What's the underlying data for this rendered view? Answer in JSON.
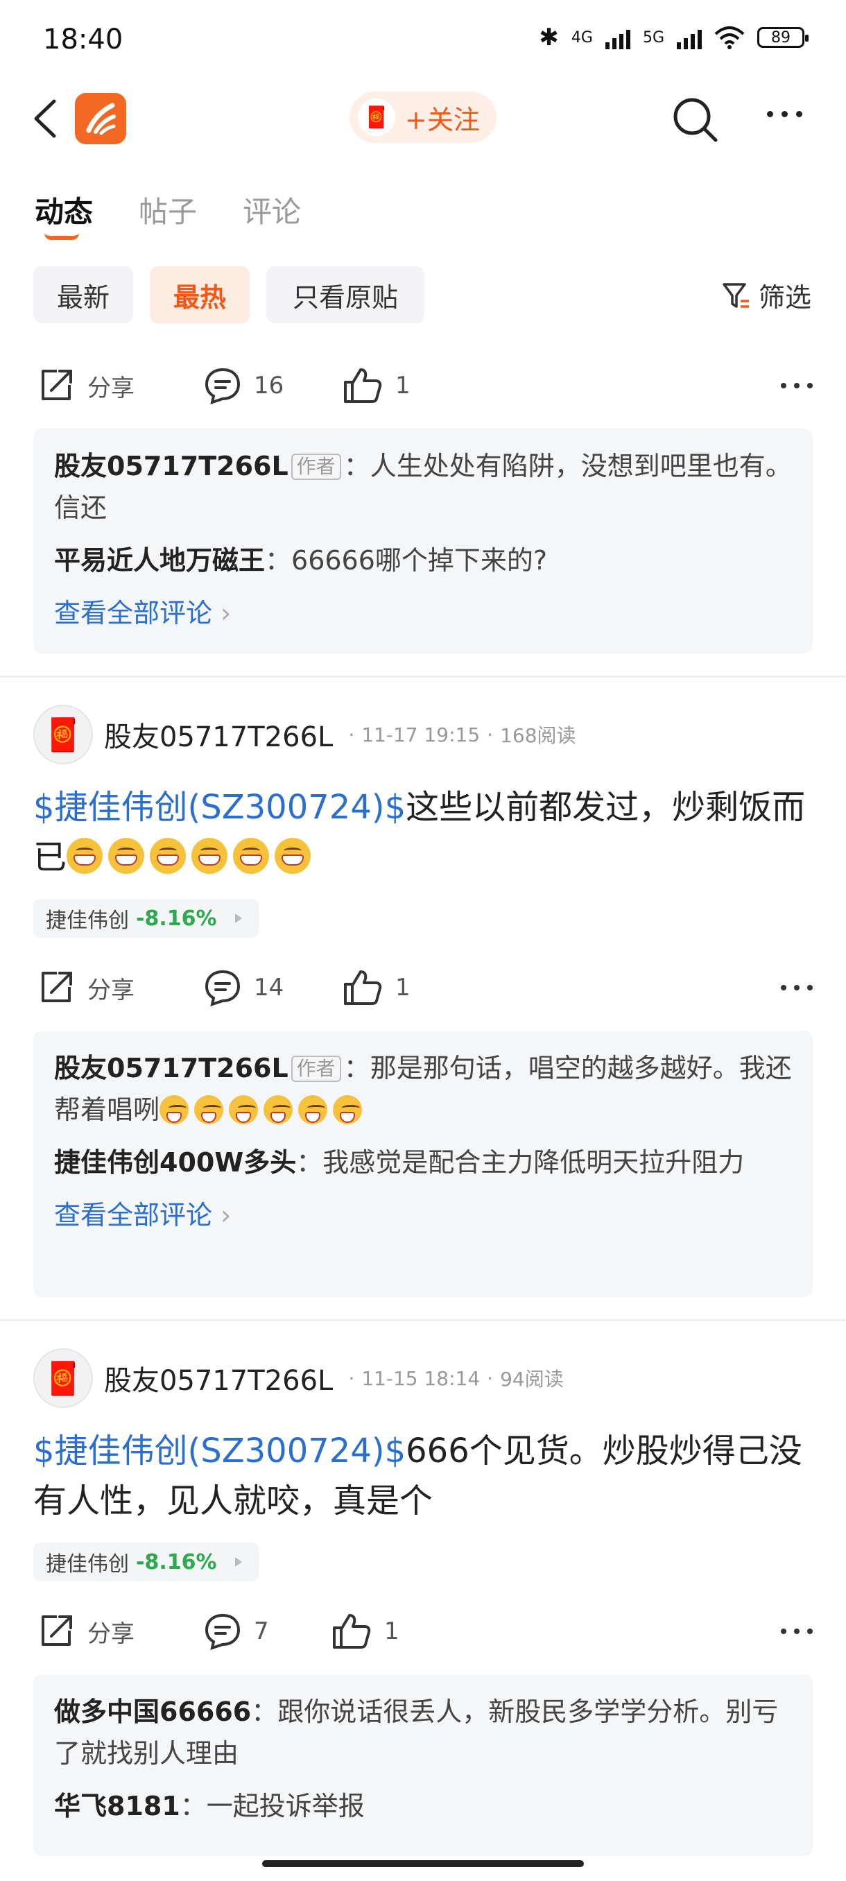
{
  "status_bar": {
    "time": "18:40",
    "net1": "4G",
    "net2": "5G",
    "battery": "89"
  },
  "header": {
    "follow_label": "+关注"
  },
  "tabs": [
    "动态",
    "帖子",
    "评论"
  ],
  "filters": [
    "最新",
    "最热",
    "只看原贴"
  ],
  "filter_button": "筛选",
  "actions": {
    "share": "分享",
    "row1": {
      "comments": "16",
      "likes": "1"
    },
    "row2": {
      "comments": "14",
      "likes": "1"
    },
    "row3": {
      "comments": "7",
      "likes": "1"
    }
  },
  "author_tag": "作者",
  "view_all": "查看全部评论",
  "block1": {
    "c1_name": "股友05717T266L",
    "c1_text": "：人生处处有陷阱，没想到吧里也有。信还",
    "c2_name": "平易近人地万磁王",
    "c2_text": "：66666哪个掉下来的?"
  },
  "post1": {
    "username": "股友05717T266L",
    "date": "11-17 19:15",
    "reads": "168阅读",
    "stock_link": "$捷佳伟创(SZ300724)$",
    "text": "这些以前都发过，炒剩饭而已",
    "chip_name": "捷佳伟创",
    "chip_change": "-8.16%"
  },
  "block2": {
    "c1_name": "股友05717T266L",
    "c1_text": "：那是那句话，唱空的越多越好。我还帮着唱咧",
    "c2_name": "捷佳伟创400W多头",
    "c2_text": "：我感觉是配合主力降低明天拉升阻力"
  },
  "post2": {
    "username": "股友05717T266L",
    "date": "11-15 18:14",
    "reads": "94阅读",
    "stock_link": "$捷佳伟创(SZ300724)$",
    "text": "666个见货。炒股炒得己没有人性，见人就咬，真是个",
    "chip_name": "捷佳伟创",
    "chip_change": "-8.16%"
  },
  "block3": {
    "c1_name": "做多中国66666",
    "c1_text": "：跟你说话很丢人，新股民多学学分析。别亏了就找别人理由",
    "c2_name": "华飞8181",
    "c2_text": "：一起投诉举报"
  }
}
